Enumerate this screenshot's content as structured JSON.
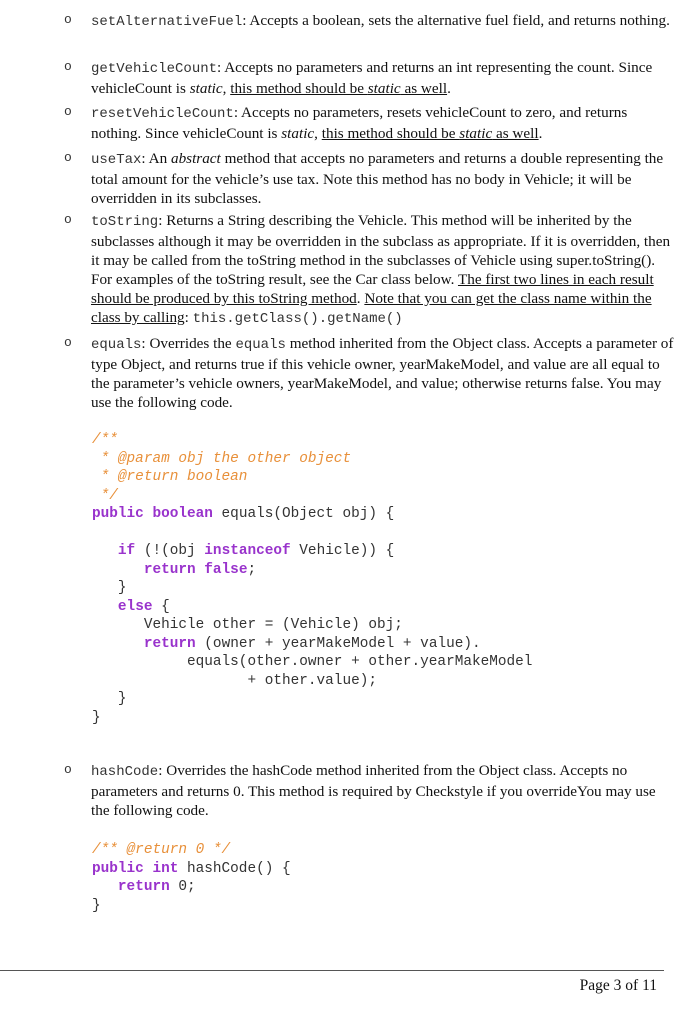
{
  "bullet_glyph": "o",
  "methods": [
    {
      "name": "setAlternativeFuel",
      "segments": [
        {
          "t": ":  Accepts a boolean, sets the alternative fuel field, and returns nothing."
        }
      ]
    },
    {
      "name": "getVehicleCount",
      "segments": [
        {
          "t": ": Accepts no parameters and returns an int representing the count. Since vehicleCount is "
        },
        {
          "t": "static",
          "style": "i"
        },
        {
          "t": ", "
        },
        {
          "t": "this method should be ",
          "style": "u"
        },
        {
          "t": "static",
          "style": "u i"
        },
        {
          "t": " as well",
          "style": "u"
        },
        {
          "t": "."
        }
      ]
    },
    {
      "name": "resetVehicleCount",
      "segments": [
        {
          "t": ":  Accepts no parameters, resets vehicleCount to zero, and returns nothing.  Since vehicleCount is "
        },
        {
          "t": "static",
          "style": "i"
        },
        {
          "t": ", "
        },
        {
          "t": "this method should be ",
          "style": "u"
        },
        {
          "t": "static",
          "style": "u i"
        },
        {
          "t": " as well",
          "style": "u"
        },
        {
          "t": "."
        }
      ]
    },
    {
      "name": "useTax",
      "segments": [
        {
          "t": ":  An "
        },
        {
          "t": "abstract",
          "style": "i"
        },
        {
          "t": " method  that accepts no parameters and returns a double representing the total amount for the vehicle’s use tax.  Note this method has no body in Vehicle; it will be overridden in its subclasses."
        }
      ]
    },
    {
      "name": "toString",
      "segments": [
        {
          "t": ":  Returns a String describing the Vehicle.  This method will be inherited by the subclasses although it may be overridden in the subclass as appropriate.  If it is overridden, then it may be called from the toString method in the subclasses of Vehicle using super.toString().  For examples of the toString result, see the Car class below.  "
        },
        {
          "t": "The first two lines in each result should be produced by this toString method",
          "style": "u"
        },
        {
          "t": ".  "
        },
        {
          "t": "Note that you can get the class name within the class by calling",
          "style": "u"
        },
        {
          "t": ":  "
        },
        {
          "t": "this.getClass().getName()",
          "style": "mono"
        }
      ]
    },
    {
      "name": "equals",
      "segments": [
        {
          "t": ":  Overrides the "
        },
        {
          "t": "equals",
          "style": "mono"
        },
        {
          "t": " method inherited from the Object class. Accepts a parameter of type Object, and returns true if this vehicle owner, yearMakeModel, and value are all equal to the parameter’s vehicle owners, yearMakeModel, and value; otherwise returns false.  You may use the following code."
        }
      ]
    },
    {
      "name": "hashCode",
      "segments": [
        {
          "t": ":  Overrides the hashCode method inherited from the Object class.  Accepts no parameters and returns 0.  This method is required by Checkstyle if you overrideYou may use the following code."
        }
      ]
    }
  ],
  "equals_code": [
    [
      {
        "t": "/**",
        "c": "cm"
      }
    ],
    [
      {
        "t": " * @param obj the other object",
        "c": "cm"
      }
    ],
    [
      {
        "t": " * @return boolean",
        "c": "cm"
      }
    ],
    [
      {
        "t": " */",
        "c": "cm"
      }
    ],
    [
      {
        "t": "public boolean",
        "c": "kw"
      },
      {
        "t": " equals(Object obj) {"
      }
    ],
    [
      {
        "t": ""
      }
    ],
    [
      {
        "t": "   "
      },
      {
        "t": "if",
        "c": "kw"
      },
      {
        "t": " (!(obj "
      },
      {
        "t": "instanceof",
        "c": "kw"
      },
      {
        "t": " Vehicle)) {"
      }
    ],
    [
      {
        "t": "      "
      },
      {
        "t": "return false",
        "c": "kw"
      },
      {
        "t": ";"
      }
    ],
    [
      {
        "t": "   }"
      }
    ],
    [
      {
        "t": "   "
      },
      {
        "t": "else",
        "c": "kw"
      },
      {
        "t": " {"
      }
    ],
    [
      {
        "t": "      Vehicle other = (Vehicle) obj;"
      }
    ],
    [
      {
        "t": "      "
      },
      {
        "t": "return",
        "c": "kw"
      },
      {
        "t": " (owner + yearMakeModel + value)."
      }
    ],
    [
      {
        "t": "           equals(other.owner + other.yearMakeModel"
      }
    ],
    [
      {
        "t": "                  + other.value);"
      }
    ],
    [
      {
        "t": "   }"
      }
    ],
    [
      {
        "t": "}"
      }
    ]
  ],
  "hashcode_code": [
    [
      {
        "t": "/** @return 0 */",
        "c": "cm"
      }
    ],
    [
      {
        "t": "public int",
        "c": "kw"
      },
      {
        "t": " hashCode() {"
      }
    ],
    [
      {
        "t": "   "
      },
      {
        "t": "return",
        "c": "kw"
      },
      {
        "t": " 0;"
      }
    ],
    [
      {
        "t": "}"
      }
    ]
  ],
  "footer": {
    "page_label": "Page 3 of 11"
  }
}
